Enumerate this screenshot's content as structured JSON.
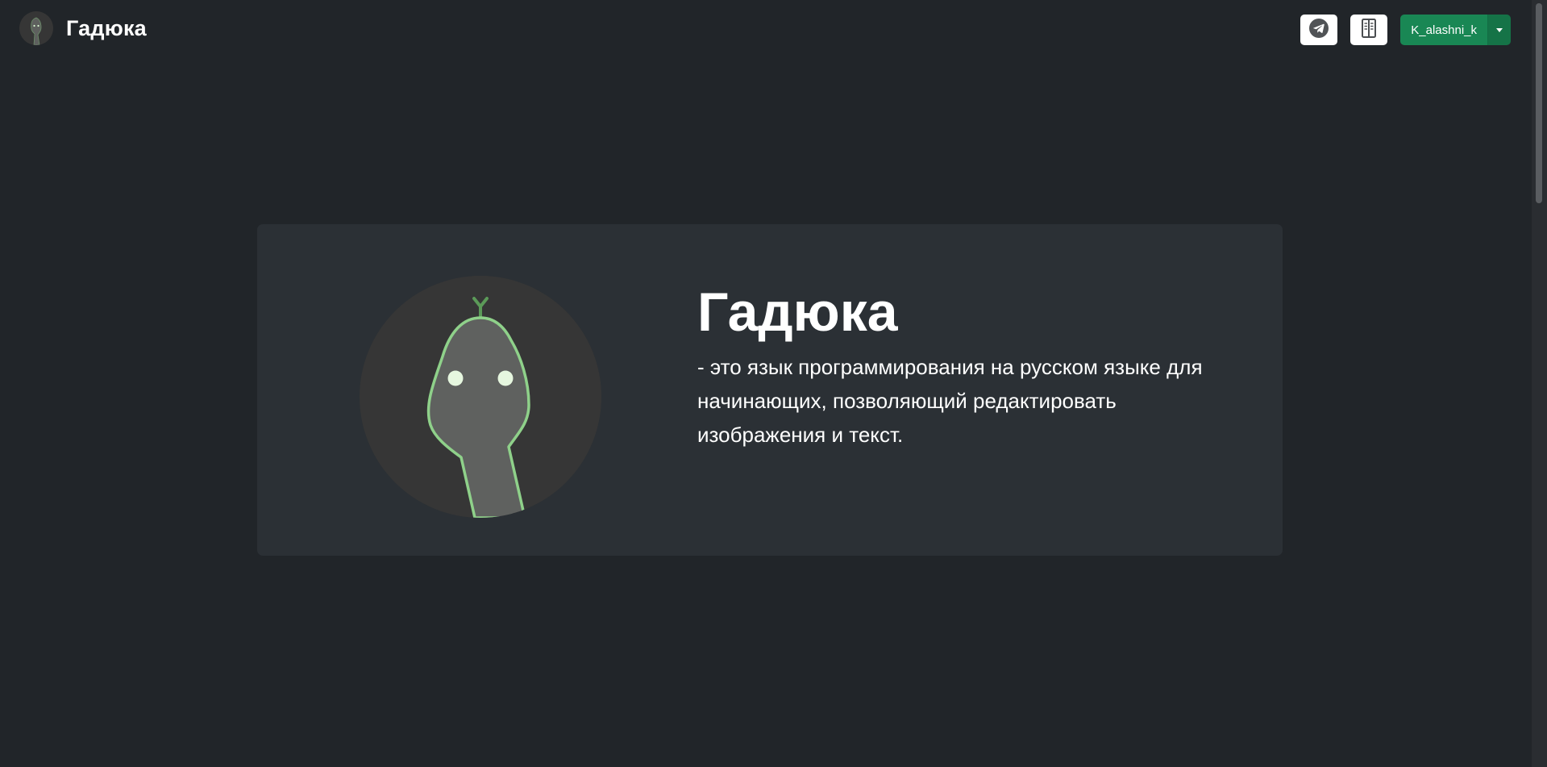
{
  "navbar": {
    "brand_title": "Гадюка",
    "brand_logo_icon": "snake-logo-icon",
    "telegram_icon": "telegram-icon",
    "docs_icon": "book-icon",
    "user_name": "K_alashni_k"
  },
  "hero": {
    "title": "Гадюка",
    "description": "- это язык программирования на русском языке для начинающих, позволяющий редактировать изображения и текст.",
    "image_icon": "snake-mascot-icon"
  },
  "colors": {
    "background": "#212529",
    "card": "#2b3035",
    "accent_green": "#198754",
    "snake_outline": "#8fd18a"
  }
}
